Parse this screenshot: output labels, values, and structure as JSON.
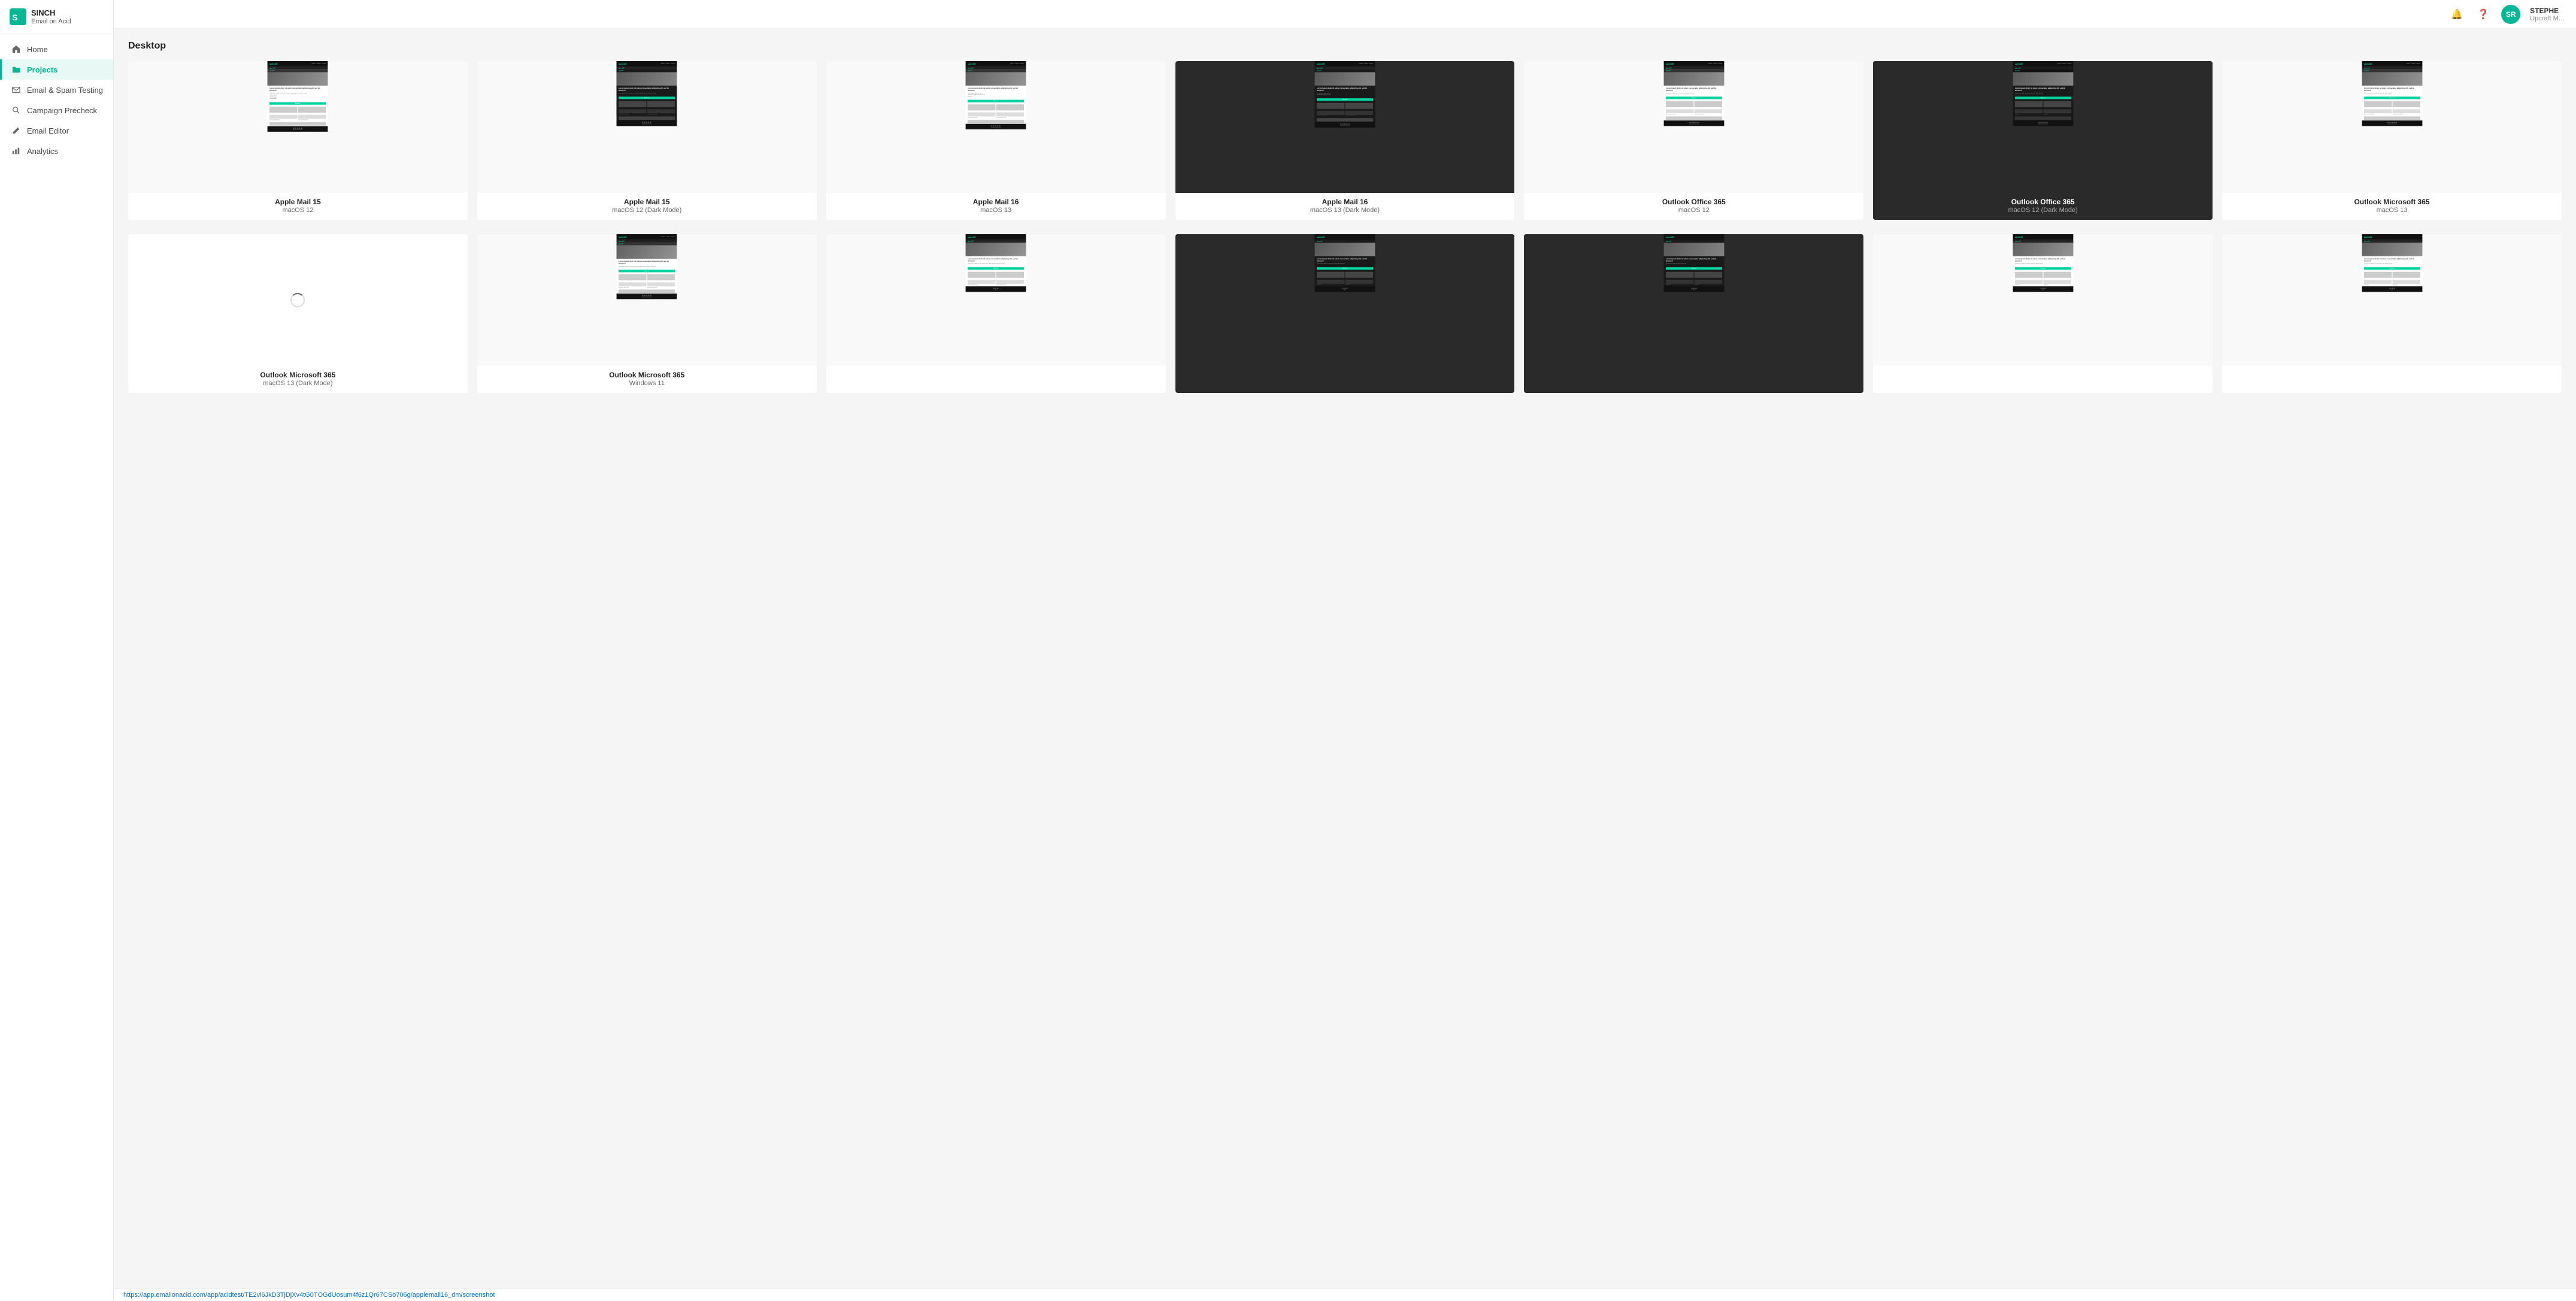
{
  "app": {
    "logo_line1": "SINCH",
    "logo_line2": "Email on Acid"
  },
  "nav": {
    "items": [
      {
        "id": "home",
        "label": "Home",
        "icon": "home"
      },
      {
        "id": "projects",
        "label": "Projects",
        "icon": "folder",
        "active": true
      },
      {
        "id": "email-spam-testing",
        "label": "Email & Spam Testing",
        "icon": "envelope"
      },
      {
        "id": "campaign-precheck",
        "label": "Campaign Precheck",
        "icon": "search"
      },
      {
        "id": "email-editor",
        "label": "Email Editor",
        "icon": "pencil"
      },
      {
        "id": "analytics",
        "label": "Analytics",
        "icon": "chart"
      }
    ]
  },
  "topbar": {
    "bell_label": "notifications",
    "help_label": "help",
    "avatar_initials": "SR",
    "user_name": "STEPHE",
    "user_sub": "Upcraft M..."
  },
  "main": {
    "section_title": "Desktop",
    "row1": [
      {
        "id": "apple-mail-15-1",
        "name": "Apple Mail 15",
        "os": "macOS 12",
        "dark": false,
        "loading": false
      },
      {
        "id": "apple-mail-15-2",
        "name": "Apple Mail 15",
        "os": "macOS 12 (Dark Mode)",
        "dark": false,
        "loading": false
      },
      {
        "id": "apple-mail-16-1",
        "name": "Apple Mail 16",
        "os": "macOS 13",
        "dark": false,
        "loading": false
      },
      {
        "id": "apple-mail-16-2",
        "name": "Apple Mail 16",
        "os": "macOS 13 (Dark Mode)",
        "dark": false,
        "loading": false
      },
      {
        "id": "outlook-365-1",
        "name": "Outlook Office 365",
        "os": "macOS 12",
        "dark": false,
        "loading": false
      },
      {
        "id": "outlook-365-dark",
        "name": "Outlook Office 365",
        "os": "macOS 12 (Dark Mode)",
        "dark": true,
        "loading": false
      },
      {
        "id": "outlook-ms-365",
        "name": "Outlook Microsoft 365",
        "os": "macOS 13",
        "dark": false,
        "loading": false
      }
    ],
    "row2": [
      {
        "id": "outlook-ms-365-dark",
        "name": "Outlook Microsoft 365",
        "os": "macOS 13 (Dark Mode)",
        "dark": false,
        "loading": true
      },
      {
        "id": "outlook-ms-365-win",
        "name": "Outlook Microsoft 365",
        "os": "Windows 11",
        "dark": false,
        "loading": false
      },
      {
        "id": "outlook-ms-365-w2",
        "name": "",
        "os": "",
        "dark": false,
        "loading": false
      },
      {
        "id": "outlook-ms-365-w3",
        "name": "",
        "os": "",
        "dark": true,
        "loading": false
      },
      {
        "id": "outlook-ms-365-w4",
        "name": "",
        "os": "",
        "dark": true,
        "loading": false
      },
      {
        "id": "outlook-ms-365-w5",
        "name": "",
        "os": "",
        "dark": false,
        "loading": false
      },
      {
        "id": "outlook-ms-365-w6",
        "name": "",
        "os": "",
        "dark": false,
        "loading": false
      }
    ]
  },
  "statusbar": {
    "url": "https://app.emailonacid.com/app/acidtest/TE2vl6JkD3TjDjXv4tG0TOGdUosum4f6z1Qr67CSo706g/applemail16_dm/screenshot"
  }
}
